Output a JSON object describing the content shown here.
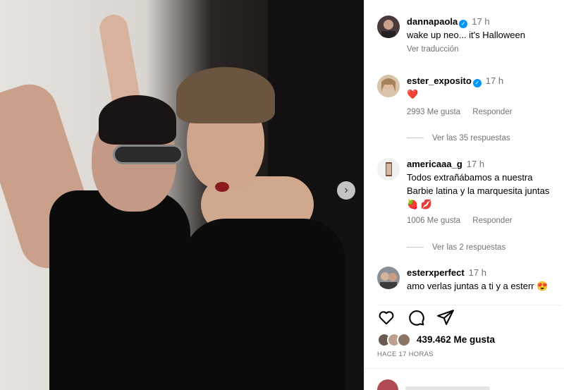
{
  "post": {
    "photo_alt": "Two women in Halloween costumes",
    "next_icon": "chevron-right-icon"
  },
  "comments": [
    {
      "username": "dannapaola",
      "verified": true,
      "time": "17 h",
      "text": "wake up neo... it's Halloween",
      "translate": "Ver traducción"
    },
    {
      "username": "ester_exposito",
      "verified": true,
      "time": "17 h",
      "text": "❤️",
      "likes": "2993 Me gusta",
      "reply": "Responder",
      "view_replies": "Ver las 35 respuestas"
    },
    {
      "username": "americaaa_g",
      "verified": false,
      "time": "17 h",
      "text_line1": "Todos extrañábamos a nuestra",
      "text_line2": "Barbie latina y la marquesita juntas",
      "text_line3": "🍓 💋",
      "likes": "1006 Me gusta",
      "reply": "Responder",
      "view_replies": "Ver las 2 respuestas"
    },
    {
      "username": "esterxperfect",
      "verified": false,
      "time": "17 h",
      "text": "amo verlas juntas a ti y a esterr 😍"
    }
  ],
  "actions": {
    "like_icon": "heart-icon",
    "comment_icon": "comment-icon",
    "share_icon": "share-icon"
  },
  "likes_total": "439.462 Me gusta",
  "posted_ago": "HACE 17 HORAS",
  "colors": {
    "verified": "#0095f6",
    "secondary_text": "#737373",
    "divider": "#efefef"
  }
}
